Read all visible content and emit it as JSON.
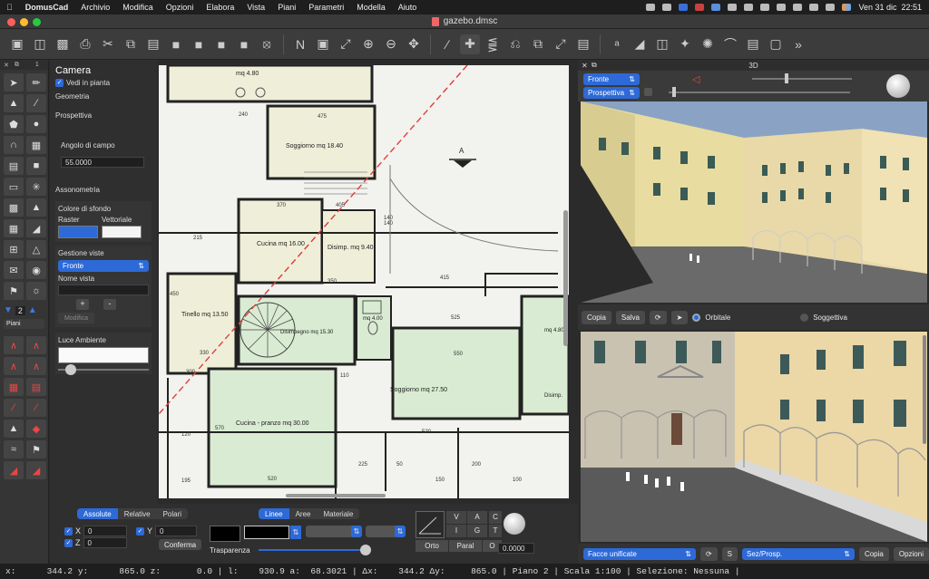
{
  "menubar": {
    "app": "DomusCad",
    "items": [
      "Archivio",
      "Modifica",
      "Opzioni",
      "Elabora",
      "Vista",
      "Piani",
      "Parametri",
      "Modella",
      "Aiuto"
    ],
    "clock": "Ven 31 dic  22:51"
  },
  "window": {
    "title": "gazebo.dmsc"
  },
  "palette": {
    "tab_number": "1",
    "level_number": "2",
    "plan_select": "Piani"
  },
  "props": {
    "title": "Camera",
    "plan_view_check": "Vedi in pianta",
    "geometry": "Geometria",
    "perspective": "Prospettiva",
    "fov_label": "Angolo di campo",
    "fov_value": "55.0000",
    "axonometry": "Assonometria",
    "bg_color_label": "Colore di sfondo",
    "raster": "Raster",
    "vector": "Vettoriale",
    "view_mgmt": "Gestione viste",
    "view_select": "Fronte",
    "view_name_label": "Nome vista",
    "view_name_value": "",
    "add": "+",
    "remove": "-",
    "modify": "Modifica",
    "ambient_light": "Luce Ambiente"
  },
  "drawing": {
    "rooms": [
      "mq 4.80",
      "Soggiorno mq 18.40",
      "Cucina mq 16.00",
      "Disimp. mq 9.40",
      "Tinello mq 13.50",
      "Disimpegno mq 15.30",
      "mq 4.00",
      "Soggiorno mq 27.50",
      "Cucina - pranzo mq 30.00",
      "mq 4.80",
      "Disimp."
    ],
    "section_mark": "A",
    "dims": [
      "475",
      "240",
      "370",
      "405",
      "140",
      "140",
      "415",
      "215",
      "525",
      "550",
      "520",
      "520",
      "225",
      "50",
      "200",
      "150",
      "100",
      "110",
      "120",
      "195",
      "570",
      "450",
      "330",
      "300",
      "350"
    ]
  },
  "view3d": {
    "header": "3D",
    "top_select_1": "Fronte",
    "top_select_2": "Prospettiva",
    "copy": "Copia",
    "save": "Salva",
    "orbital": "Orbitale",
    "subjective": "Soggettiva",
    "faces_select": "Facce unificate",
    "s_button": "S",
    "section_select": "Sez/Prosp.",
    "copy2": "Copia",
    "options": "Opzioni"
  },
  "bottom": {
    "coord_tabs": [
      "Assolute",
      "Relative",
      "Polari"
    ],
    "x_label": "X",
    "x_value": "0",
    "y_label": "Y",
    "y_value": "0",
    "z_label": "Z",
    "z_value": "0",
    "confirm": "Conferma",
    "mat_tabs": [
      "Linee",
      "Aree",
      "Materiale"
    ],
    "transparency": "Trasparenza",
    "grid_letters": [
      "V",
      "A",
      "C",
      "I",
      "G",
      "T"
    ],
    "orto": "Orto",
    "paral": "Paral",
    "o": "O",
    "angle_value": "0.0000"
  },
  "status": {
    "text": "x:      344.2 y:      865.0 z:       0.0 | l:    930.9 a:  68.3021 | Δx:    344.2 Δy:     865.0 | Piano 2 | Scala 1:100 | Selezione: Nessuna |"
  },
  "colors": {
    "accent": "#2d6ad8",
    "room_green": "#d9ecd3",
    "room_cream": "#efefd9",
    "section_line": "#e03c3c",
    "facade": "#eadca0"
  }
}
